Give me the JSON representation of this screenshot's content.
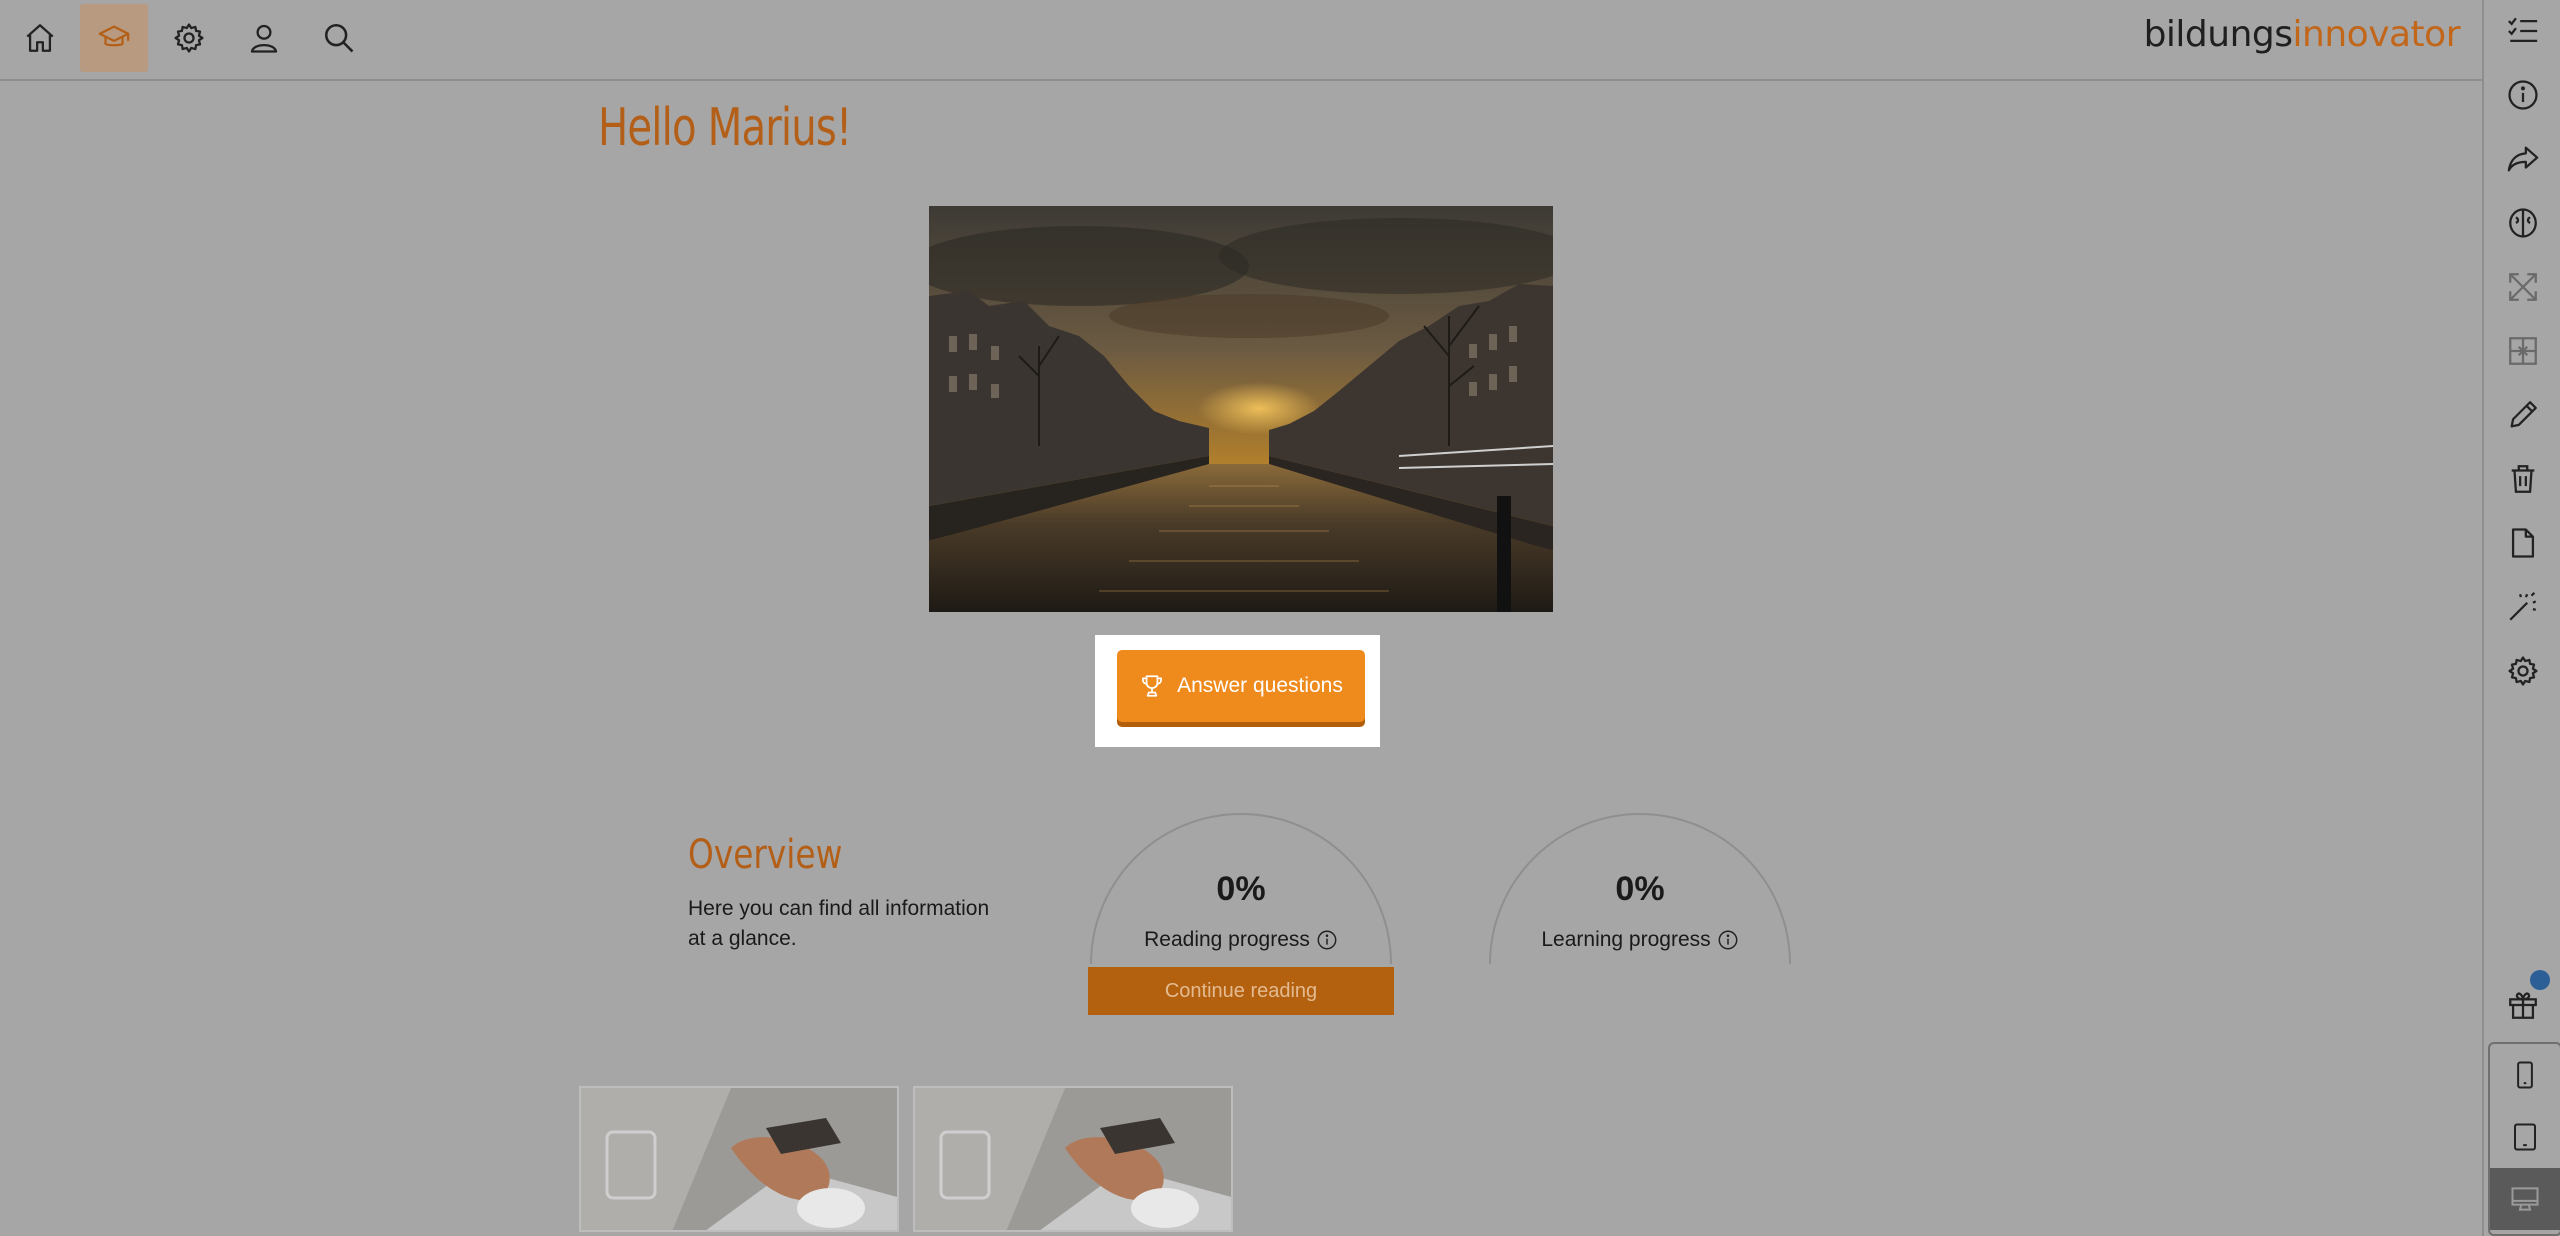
{
  "brand": {
    "part1": "bildungs",
    "part2": "innovator"
  },
  "nav": {
    "items": [
      {
        "icon": "home-icon",
        "active": false
      },
      {
        "icon": "graduation-cap-icon",
        "active": true
      },
      {
        "icon": "gear-icon",
        "active": false
      },
      {
        "icon": "user-icon",
        "active": false
      },
      {
        "icon": "search-icon",
        "active": false
      }
    ]
  },
  "rail": {
    "tools": [
      "checklist-icon",
      "info-icon",
      "share-icon",
      "brain-icon",
      "expand-icon",
      "layout-grid-icon",
      "pencil-icon",
      "trash-icon",
      "document-icon",
      "magic-wand-icon",
      "gear-icon"
    ],
    "gift": "gift-icon",
    "devices": [
      "phone-icon",
      "tablet-icon",
      "desktop-icon"
    ],
    "active_device": "desktop-icon"
  },
  "greeting": "Hello Marius!",
  "hero": {
    "image": "canal-sunset-photo"
  },
  "answer_button": {
    "label": "Answer questions",
    "icon": "trophy-icon"
  },
  "overview": {
    "title": "Overview",
    "description": "Here you can find all information at a glance."
  },
  "progress": [
    {
      "value": "0%",
      "label": "Reading progress",
      "icon": "info-icon"
    },
    {
      "value": "0%",
      "label": "Learning progress",
      "icon": "info-icon"
    }
  ],
  "continue_button": {
    "label": "Continue reading"
  },
  "cards": [
    {
      "image": "phone-laptop-photo",
      "icon": "tablet-icon"
    },
    {
      "image": "phone-laptop-photo",
      "icon": "tablet-icon"
    }
  ],
  "colors": {
    "accent": "#ef8a1c",
    "accent_dark": "#b45f18",
    "overlay_bg": "#a6a6a6"
  }
}
